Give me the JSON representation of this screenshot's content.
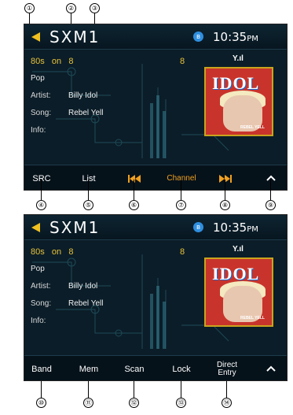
{
  "callouts_top": [
    "①",
    "②",
    "③"
  ],
  "callouts_bottom_screen1": [
    "④",
    "⑤",
    "⑥",
    "⑦",
    "⑧",
    "⑨"
  ],
  "callouts_bottom_screen2": [
    "⑩",
    "⑪",
    "⑫",
    "⑬",
    "⑭"
  ],
  "colors": {
    "accent_orange": "#f0a020",
    "category_yellow": "#e8c23a",
    "bluetooth_blue": "#2f8fe0",
    "album_border": "#c9a41d"
  },
  "screen1": {
    "header": {
      "back_icon": "back-triangle-icon",
      "title": "SXM1",
      "bluetooth_icon": "bluetooth-icon",
      "bluetooth_glyph": "ʙ",
      "time": "10:35",
      "ampm": "PM"
    },
    "info": {
      "category": "80s",
      "on": "on",
      "channel_num": "8",
      "channel_right": "8",
      "genre": "Pop",
      "artist_label": "Artist:",
      "artist": "Billy Idol",
      "song_label": "Song:",
      "song": "Rebel Yell",
      "info_label": "Info:",
      "signal": "Y.ıl"
    },
    "album": {
      "title": "IDOL",
      "caption": "REBEL YELL"
    },
    "buttons": {
      "src": "SRC",
      "list": "List",
      "prev_icon": "skip-previous-icon",
      "channel": "Channel",
      "next_icon": "skip-next-icon",
      "up_icon": "chevron-up-icon"
    }
  },
  "screen2": {
    "header": {
      "back_icon": "back-triangle-icon",
      "title": "SXM1",
      "bluetooth_icon": "bluetooth-icon",
      "bluetooth_glyph": "ʙ",
      "time": "10:35",
      "ampm": "PM"
    },
    "info": {
      "category": "80s",
      "on": "on",
      "channel_num": "8",
      "channel_right": "8",
      "genre": "Pop",
      "artist_label": "Artist:",
      "artist": "Billy Idol",
      "song_label": "Song:",
      "song": "Rebel Yell",
      "info_label": "Info:",
      "signal": "Y.ıl"
    },
    "album": {
      "title": "IDOL",
      "caption": "REBEL YELL"
    },
    "buttons": {
      "band": "Band",
      "mem": "Mem",
      "scan": "Scan",
      "lock": "Lock",
      "direct_line1": "Direct",
      "direct_line2": "Entry",
      "up_icon": "chevron-up-icon"
    }
  }
}
